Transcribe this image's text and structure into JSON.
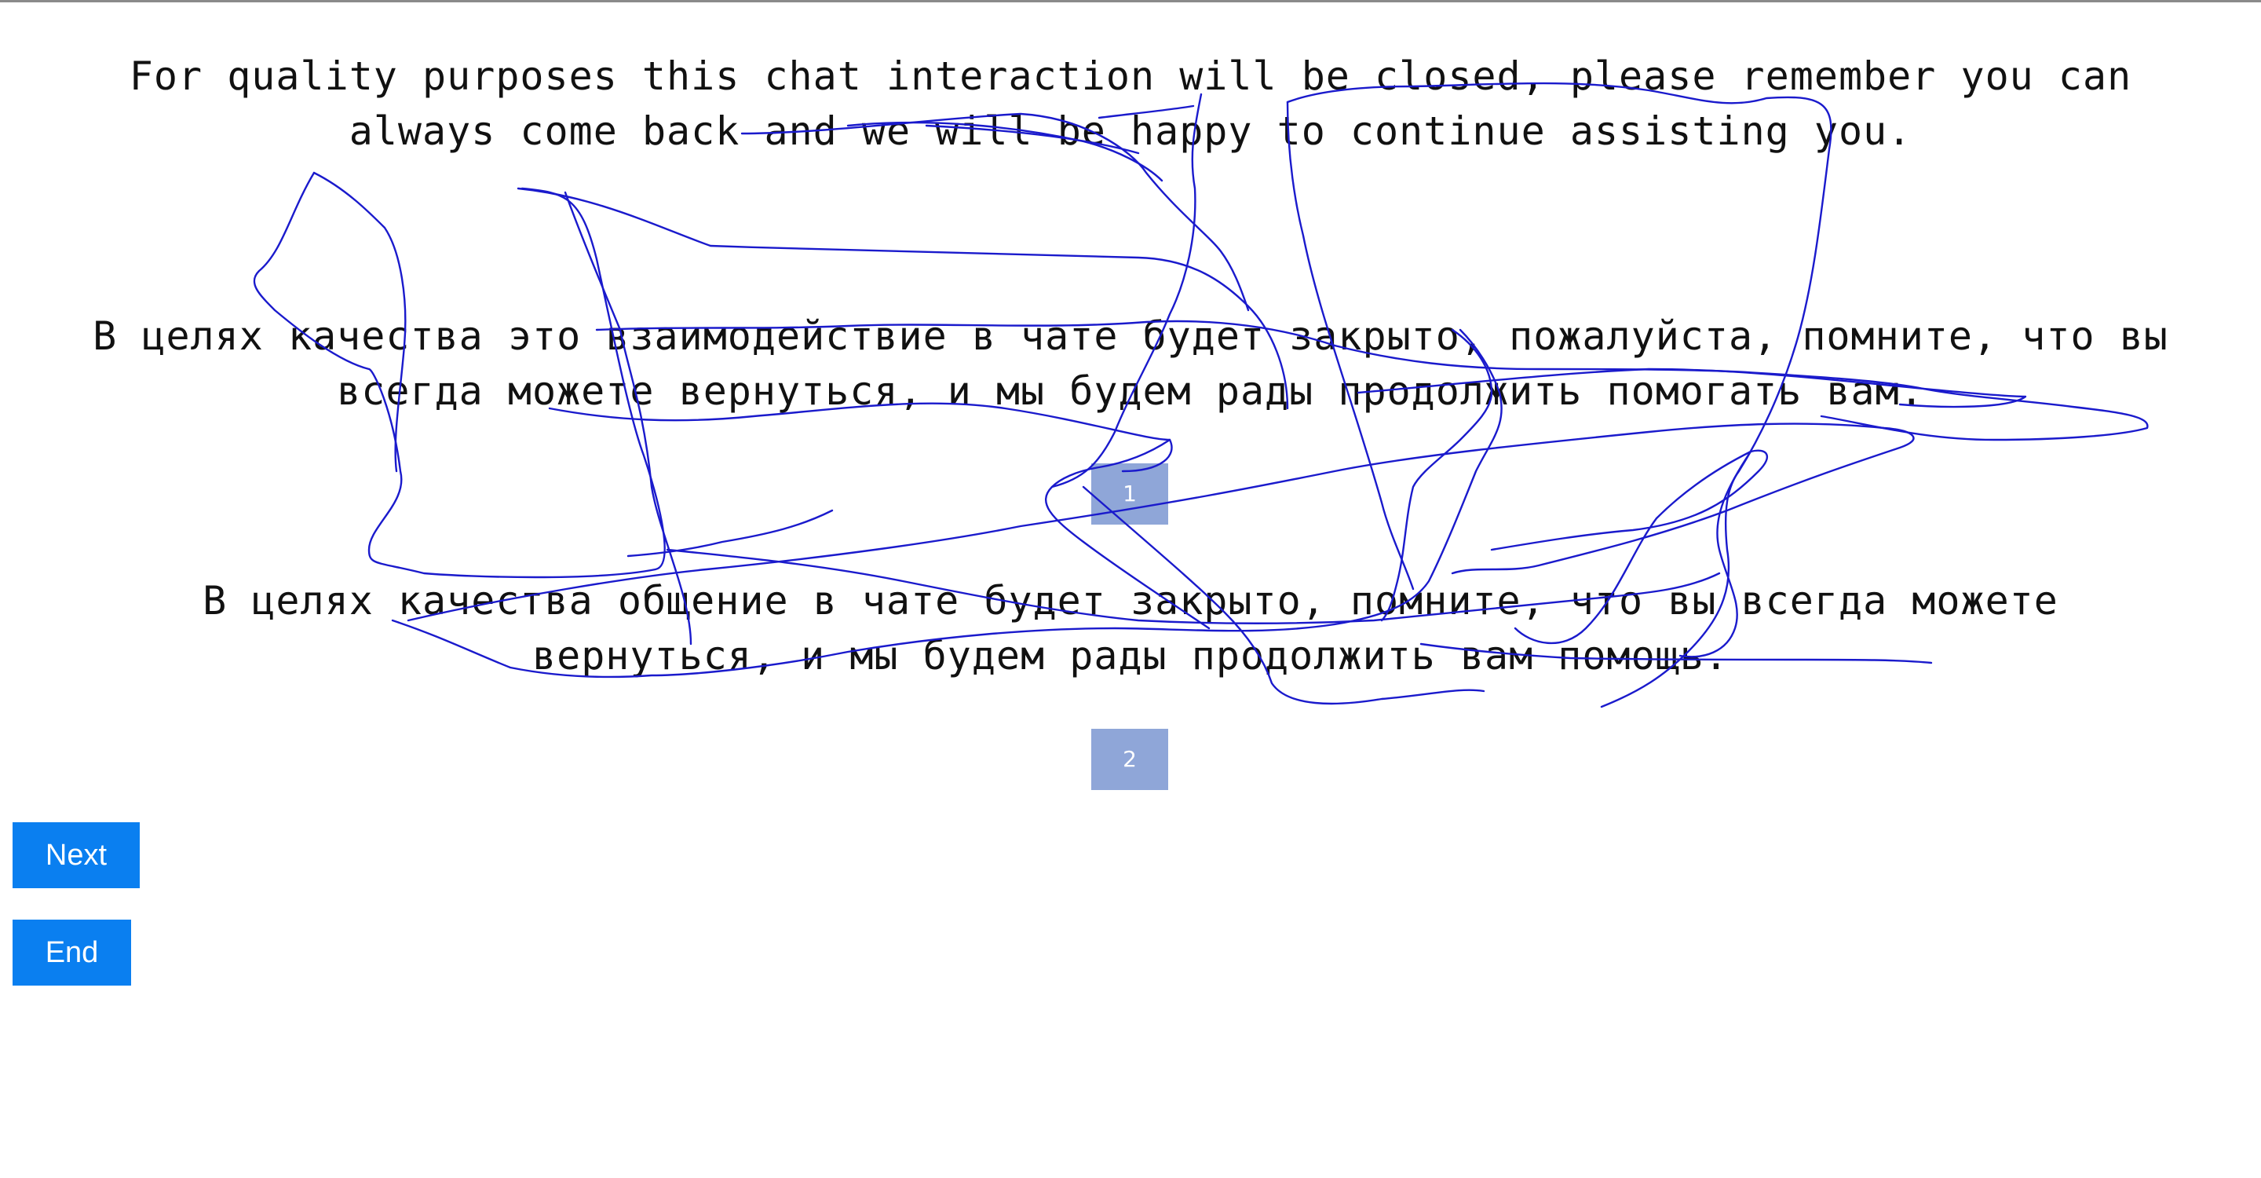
{
  "source_text": {
    "line1": "For quality purposes this chat interaction will be closed, please remember you can",
    "line2": "always come back and we will be happy to continue assisting you."
  },
  "options": [
    {
      "line1": "В целях качества это взаимодействие в чате будет закрыто, пожалуйста, помните, что вы",
      "line2": "всегда можете вернуться, и мы будем рады продолжить помогать вам.",
      "badge": "1"
    },
    {
      "line1": "В целях качества общение в чате будет закрыто, помните, что вы всегда можете",
      "line2": "вернуться, и мы будем рады продолжить вам помощь.",
      "badge": "2"
    }
  ],
  "buttons": {
    "next": "Next",
    "end": "End"
  },
  "colors": {
    "button": "#0a7ff0",
    "badge": "#8fa6d8",
    "scribble": "#1a1acc"
  }
}
